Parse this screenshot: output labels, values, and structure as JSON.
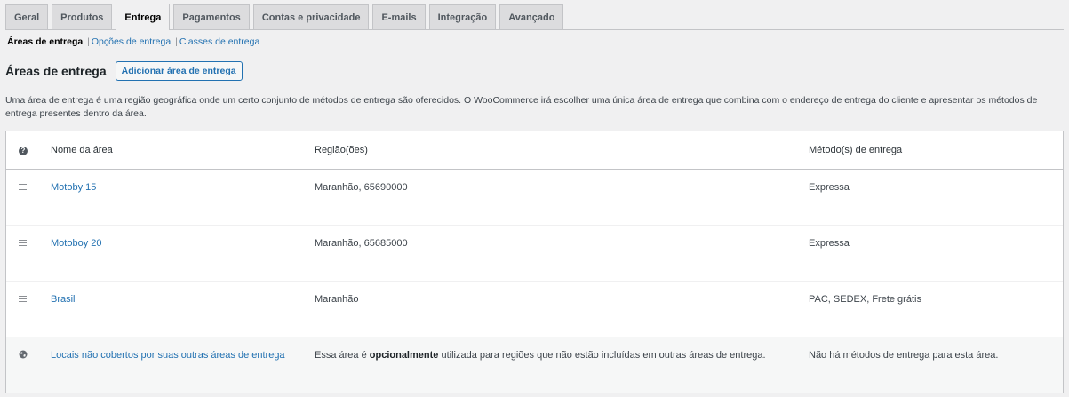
{
  "tabs": [
    {
      "label": "Geral",
      "active": false
    },
    {
      "label": "Produtos",
      "active": false
    },
    {
      "label": "Entrega",
      "active": true
    },
    {
      "label": "Pagamentos",
      "active": false
    },
    {
      "label": "Contas e privacidade",
      "active": false
    },
    {
      "label": "E-mails",
      "active": false
    },
    {
      "label": "Integração",
      "active": false
    },
    {
      "label": "Avançado",
      "active": false
    }
  ],
  "subnav": {
    "current": "Áreas de entrega",
    "links": [
      "Opções de entrega",
      "Classes de entrega"
    ],
    "separator": "|"
  },
  "page": {
    "title": "Áreas de entrega",
    "add_button": "Adicionar área de entrega",
    "description": "Uma área de entrega é uma região geográfica onde um certo conjunto de métodos de entrega são oferecidos. O WooCommerce irá escolher uma única área de entrega que combina com o endereço de entrega do cliente e apresentar os métodos de entrega presentes dentro da área."
  },
  "table": {
    "help_icon": "help-icon",
    "headers": {
      "name": "Nome da área",
      "regions": "Região(ões)",
      "methods": "Método(s) de entrega"
    },
    "rows": [
      {
        "name": "Motoby 15",
        "regions": "Maranhão, 65690000",
        "methods": "Expressa",
        "icon": "drag-handle-icon"
      },
      {
        "name": "Motoboy 20",
        "regions": "Maranhão, 65685000",
        "methods": "Expressa",
        "icon": "drag-handle-icon"
      },
      {
        "name": "Brasil",
        "regions": "Maranhão",
        "methods": "PAC, SEDEX, Frete grátis",
        "icon": "drag-handle-icon"
      }
    ],
    "fallback": {
      "icon": "globe-icon",
      "name": "Locais não cobertos por suas outras áreas de entrega",
      "regions_pre": "Essa área é",
      "regions_bold": "opcionalmente",
      "regions_post": "utilizada para regiões que não estão incluídas em outras áreas de entrega.",
      "methods": "Não há métodos de entrega para esta área."
    }
  },
  "colors": {
    "link": "#2271b1",
    "background": "#f0f0f1",
    "tab_inactive": "#dcdcde"
  }
}
